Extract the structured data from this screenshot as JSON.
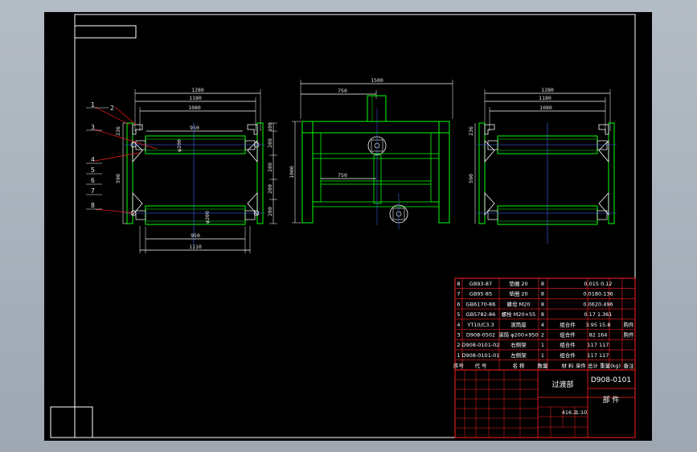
{
  "colors": {
    "background": "#000000",
    "frame": "#ffffff",
    "construction": "#00ff00",
    "dimension": "#ffffff",
    "axis": "#4a6cff",
    "redline": "#ff2020",
    "title_block": "#ff2020"
  },
  "left_view": {
    "dims_top": [
      "1280",
      "1180",
      "1080"
    ],
    "dim_inner_top": "950",
    "dim_inner_bottom": "950",
    "dim_bottom": "1110",
    "dim_left_236": "236",
    "dim_left_590": "590",
    "roller_dia_top": "φ200",
    "roller_dia_bottom": "φ200",
    "right_dims": [
      "100",
      "280",
      "280",
      "280",
      "280"
    ],
    "part_labels": [
      "1",
      "2",
      "3",
      "4",
      "5",
      "6",
      "7",
      "8"
    ]
  },
  "mid_view": {
    "dim_top": "1500",
    "dim_750_top": "750",
    "dim_750_mid": "750",
    "dim_height": "1000"
  },
  "right_view": {
    "dims_top": [
      "1280",
      "1180",
      "1080"
    ],
    "dim_left": "236",
    "dim_left_590": "590"
  },
  "bom": {
    "rows": [
      {
        "no": "8",
        "code": "GB93-87",
        "name": "垫圈 20",
        "qty": "8",
        "mass": "0.015 0.12",
        "note": ""
      },
      {
        "no": "7",
        "code": "GB95-85",
        "name": "垫圈 20",
        "qty": "8",
        "mass": "0.0180.136",
        "note": ""
      },
      {
        "no": "6",
        "code": "GB6170-86",
        "name": "螺母 M20",
        "qty": "8",
        "mass": "0.0620.496",
        "note": ""
      },
      {
        "no": "5",
        "code": "GB5782-86",
        "name": "螺栓 M20×55",
        "qty": "8",
        "mass": "0.17 1.361",
        "note": ""
      },
      {
        "no": "4",
        "code": "YT10/C3.3",
        "name": "滚筒座",
        "qty": "4",
        "mass": "3.95 15.8",
        "note": "购件",
        "mat": "组合件"
      },
      {
        "no": "3",
        "code": "D908-0502",
        "name": "滚筒 φ200×950",
        "qty": "2",
        "mass": "82  164",
        "note": "购件",
        "mat": "组合件"
      },
      {
        "no": "2",
        "code": "D908-0101-02",
        "name": "右侧架",
        "qty": "1",
        "mass": "117  117",
        "note": "",
        "mat": "组合件"
      },
      {
        "no": "1",
        "code": "D908-0101-01",
        "name": "左侧架",
        "qty": "1",
        "mass": "117  117",
        "note": "",
        "mat": "组合件"
      }
    ],
    "header": {
      "no": "序号",
      "code": "代 号",
      "name": "名 称",
      "qty": "数量",
      "mat": "材 料",
      "mass": "单件 总计 重量(kg)",
      "note": "备注"
    }
  },
  "title_block": {
    "name": "过渡部",
    "drawing_no": "D908-0101",
    "type": "部  件",
    "scale": "1:10",
    "weight": "416.2"
  }
}
